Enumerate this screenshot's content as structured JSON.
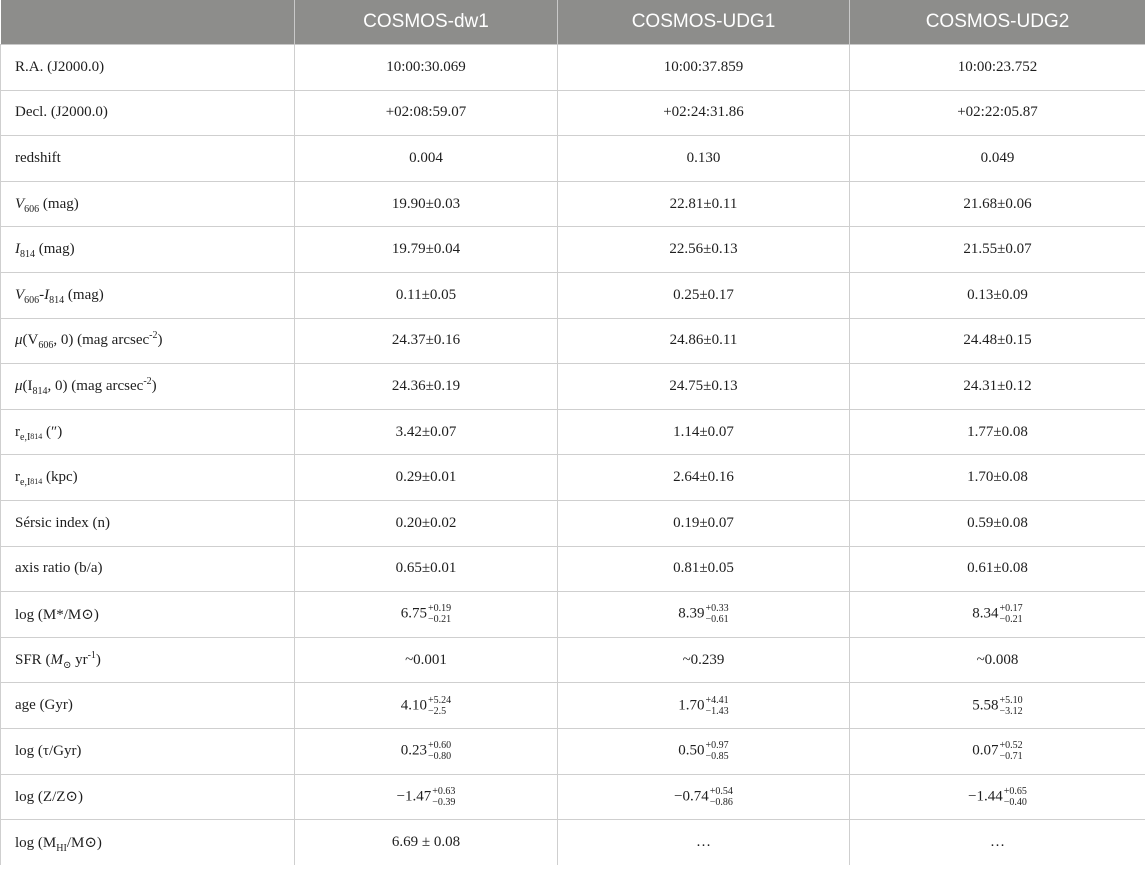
{
  "table": {
    "columns": [
      "",
      "COSMOS-dw1",
      "COSMOS-UDG1",
      "COSMOS-UDG2"
    ],
    "rows": [
      {
        "label": {
          "text": "R.A. (J2000.0)"
        },
        "values": [
          "10:00:30.069",
          "10:00:37.859",
          "10:00:23.752"
        ]
      },
      {
        "label": {
          "text": "Decl. (J2000.0)"
        },
        "values": [
          "+02:08:59.07",
          "+02:24:31.86",
          "+02:22:05.87"
        ]
      },
      {
        "label": {
          "text": "redshift"
        },
        "values": [
          "0.004",
          "0.130",
          "0.049"
        ]
      },
      {
        "label": {
          "sym": "V",
          "sub": "606",
          "tail": " (mag)"
        },
        "values": [
          "19.90±0.03",
          "22.81±0.11",
          "21.68±0.06"
        ]
      },
      {
        "label": {
          "sym": "I",
          "sub": "814",
          "tail": " (mag)"
        },
        "values": [
          "19.79±0.04",
          "22.56±0.13",
          "21.55±0.07"
        ]
      },
      {
        "label": {
          "sym": "V",
          "sub": "606",
          "mid": "-",
          "sym2": "I",
          "sub2": "814",
          "tail": " (mag)"
        },
        "values": [
          "0.11±0.05",
          "0.25±0.17",
          "0.13±0.09"
        ]
      },
      {
        "label": {
          "sym": "μ",
          "pre": "(V",
          "sub": "606",
          "mid": ", 0) (mag arcsec",
          "sup": "-2",
          "tail": ")"
        },
        "values": [
          "24.37±0.16",
          "24.86±0.11",
          "24.48±0.15"
        ]
      },
      {
        "label": {
          "sym": "μ",
          "pre": "(I",
          "sub": "814",
          "mid": ", 0) (mag arcsec",
          "sup": "-2",
          "tail": ")"
        },
        "values": [
          "24.36±0.19",
          "24.75±0.13",
          "24.31±0.12"
        ]
      },
      {
        "label": {
          "base": "r",
          "sub": "e,I",
          "sub2": "814",
          "tail": " (″)"
        },
        "values": [
          "3.42±0.07",
          "1.14±0.07",
          "1.77±0.08"
        ]
      },
      {
        "label": {
          "base": "r",
          "sub": "e,I",
          "sub2": "814",
          "tail": " (kpc)"
        },
        "values": [
          "0.29±0.01",
          "2.64±0.16",
          "1.70±0.08"
        ]
      },
      {
        "label": {
          "text": "Sérsic index (n)"
        },
        "values": [
          "0.20±0.02",
          "0.19±0.07",
          "0.59±0.08"
        ]
      },
      {
        "label": {
          "text": "axis ratio (b/a)"
        },
        "values": [
          "0.65±0.01",
          "0.81±0.05",
          "0.61±0.08"
        ]
      },
      {
        "label": {
          "text": "log (M*/M⊙)"
        },
        "values": [
          {
            "v": "6.75",
            "up": "+0.19",
            "lo": "−0.21"
          },
          {
            "v": "8.39",
            "up": "+0.33",
            "lo": "−0.61"
          },
          {
            "v": "8.34",
            "up": "+0.17",
            "lo": "−0.21"
          }
        ]
      },
      {
        "label": {
          "text": "SFR (",
          "sym": "M",
          "sub": "⊙",
          "mid": " yr",
          "sup": "-1",
          "tail": ")"
        },
        "values": [
          "~0.001",
          "~0.239",
          "~0.008"
        ]
      },
      {
        "label": {
          "text": "age (Gyr)"
        },
        "values": [
          {
            "v": "4.10",
            "up": "+5.24",
            "lo": "−2.5"
          },
          {
            "v": "1.70",
            "up": "+4.41",
            "lo": "−1.43"
          },
          {
            "v": "5.58",
            "up": "+5.10",
            "lo": "−3.12"
          }
        ]
      },
      {
        "label": {
          "text": "log (τ/Gyr)"
        },
        "values": [
          {
            "v": "0.23",
            "up": "+0.60",
            "lo": "−0.80"
          },
          {
            "v": "0.50",
            "up": "+0.97",
            "lo": "−0.85"
          },
          {
            "v": "0.07",
            "up": "+0.52",
            "lo": "−0.71"
          }
        ]
      },
      {
        "label": {
          "text": "log (Z/Z⊙)"
        },
        "values": [
          {
            "v": "−1.47",
            "up": "+0.63",
            "lo": "−0.39"
          },
          {
            "v": "−0.74",
            "up": "+0.54",
            "lo": "−0.86"
          },
          {
            "v": "−1.44",
            "up": "+0.65",
            "lo": "−0.40"
          }
        ]
      },
      {
        "label": {
          "text": "log (M",
          "sub": "HI",
          "tail": "/M⊙)"
        },
        "values": [
          "6.69 ± 0.08",
          "…",
          "…"
        ]
      }
    ]
  }
}
